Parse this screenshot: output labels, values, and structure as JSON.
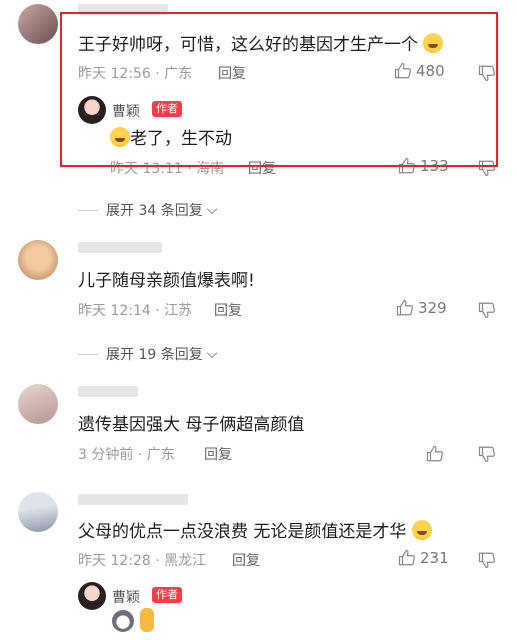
{
  "comments": [
    {
      "text": "王子好帅呀，可惜，这么好的基因才生产一个",
      "time": "昨天 12:56 · 广东",
      "reply": "回复",
      "likes": "480"
    },
    {
      "text": "儿子随母亲颜值爆表啊!",
      "time": "昨天 12:14 · 江苏",
      "reply": "回复",
      "likes": "329"
    },
    {
      "text": "遗传基因强大 母子俩超高颜值",
      "time": "3 分钟前 · 广东",
      "reply": "回复"
    },
    {
      "text": "父母的优点一点没浪费 无论是颜值还是才华",
      "time": "昨天 12:28 · 黑龙江",
      "reply": "回复",
      "likes": "231"
    }
  ],
  "author_replies": [
    {
      "name": "曹颖",
      "badge": "作者",
      "text": "老了，生不动",
      "time": "昨天 13:11 · 海南",
      "reply": "回复",
      "likes": "133"
    },
    {
      "name": "曹颖",
      "badge": "作者"
    }
  ],
  "expand": [
    {
      "label": "展开 34 条回复"
    },
    {
      "label": "展开 19 条回复"
    }
  ],
  "colors": {
    "highlight": "#e8222a",
    "badge": "#ff3b4a"
  }
}
